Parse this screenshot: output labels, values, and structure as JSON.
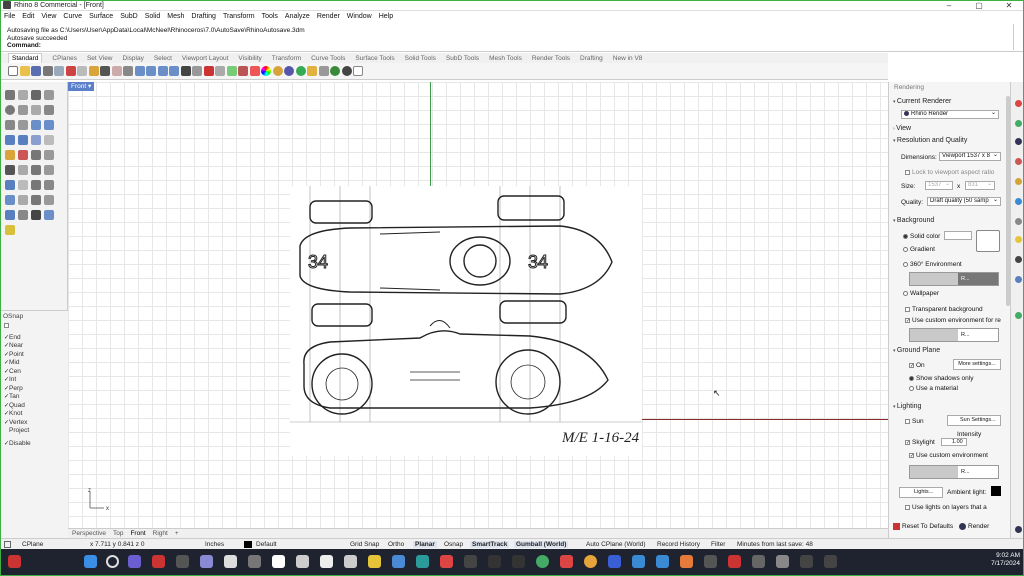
{
  "window": {
    "title": "Rhino 8 Commercial - [Front]",
    "controls": [
      "–",
      "▢",
      "✕"
    ]
  },
  "menu": [
    "File",
    "Edit",
    "View",
    "Curve",
    "Surface",
    "SubD",
    "Solid",
    "Mesh",
    "Drafting",
    "Transform",
    "Tools",
    "Analyze",
    "Render",
    "Window",
    "Help"
  ],
  "command_history": [
    "Autosaving file as C:\\Users\\User\\AppData\\Local\\McNeel\\Rhinoceros\\7.0\\AutoSave\\RhinoAutosave.3dm",
    "Autosave succeeded"
  ],
  "command_prompt": "Command:",
  "toolbar_tabs": [
    "Standard",
    "CPlanes",
    "Set View",
    "Display",
    "Select",
    "Viewport Layout",
    "Visibility",
    "Transform",
    "Curve Tools",
    "Surface Tools",
    "Solid Tools",
    "SubD Tools",
    "Mesh Tools",
    "Render Tools",
    "Drafting",
    "New in V8"
  ],
  "active_toolbar_tab": "Standard",
  "viewport": {
    "label": "Front ▾",
    "axis_x": "x",
    "axis_z": "z",
    "sketch_signature": "M/E 1-16-24"
  },
  "viewport_tabs": [
    "Perspective",
    "Top",
    "Front",
    "Right",
    "+"
  ],
  "active_viewport_tab": "Front",
  "osnap": {
    "title": "OSnap",
    "items": [
      {
        "label": "End",
        "checked": true
      },
      {
        "label": "Near",
        "checked": true
      },
      {
        "label": "Point",
        "checked": true
      },
      {
        "label": "Mid",
        "checked": true
      },
      {
        "label": "Cen",
        "checked": true
      },
      {
        "label": "Int",
        "checked": true
      },
      {
        "label": "Perp",
        "checked": true
      },
      {
        "label": "Tan",
        "checked": true
      },
      {
        "label": "Quad",
        "checked": true
      },
      {
        "label": "Knot",
        "checked": true
      },
      {
        "label": "Vertex",
        "checked": true
      },
      {
        "label": "Project",
        "checked": false
      }
    ],
    "disable_label": "Disable"
  },
  "rendering_panel": {
    "title": "Rendering",
    "current_renderer_label": "Current Renderer",
    "renderer": "Rhino Render",
    "view_label": "View",
    "resolution_label": "Resolution and Quality",
    "dimensions_label": "Dimensions:",
    "dimensions_value": "Viewport 1537 x 8",
    "lock_aspect_label": "Lock to viewport aspect ratio",
    "size_label": "Size:",
    "size_w": "1537",
    "size_x": "x",
    "size_h": "831",
    "quality_label": "Quality:",
    "quality_value": "Draft quality (50 samp",
    "background_label": "Background",
    "solid_color_label": "Solid color",
    "gradient_label": "Gradient",
    "env360_label": "360° Environment",
    "env_dropdown": "R...",
    "wallpaper_label": "Wallpaper",
    "transparent_bg_label": "Transparent background",
    "custom_env_reflect_label": "Use custom environment for re",
    "ground_plane_label": "Ground Plane",
    "gp_on_label": "On",
    "more_settings_label": "More settings...",
    "show_shadows_label": "Show shadows only",
    "use_material_label": "Use a material",
    "lighting_label": "Lighting",
    "sun_label": "Sun",
    "sun_settings_label": "Sun Settings...",
    "intensity_label": "Intensity",
    "skylight_label": "Skylight",
    "skylight_value": "1.00",
    "use_custom_env_label": "Use custom environment",
    "lights_label": "Lights...",
    "ambient_light_label": "Ambient light:",
    "lights_on_layers_label": "Use lights on layers that a",
    "reset_label": "Reset To Defaults",
    "render_label": "Render"
  },
  "status": {
    "cplane": "CPlane",
    "coords": "x 7.711  y 0.841  z 0",
    "units": "Inches",
    "layer": "Default",
    "grid_snap": "Grid Snap",
    "ortho": "Ortho",
    "planar": "Planar",
    "osnap": "Osnap",
    "smarttrack": "SmartTrack",
    "gumball": "Gumball (World)",
    "auto_cplane": "Auto CPlane (World)",
    "record_history": "Record History",
    "filter": "Filter",
    "last_save": "Minutes from last save: 48"
  },
  "taskbar": {
    "time": "9:02 AM",
    "date": "7/17/2024"
  },
  "colors": {
    "accent": "#5b7fc9",
    "y_axis": "#3c9e4a",
    "x_axis": "#8b2b2b",
    "taskbar": "#1f2330",
    "frame": "#3cb043"
  }
}
